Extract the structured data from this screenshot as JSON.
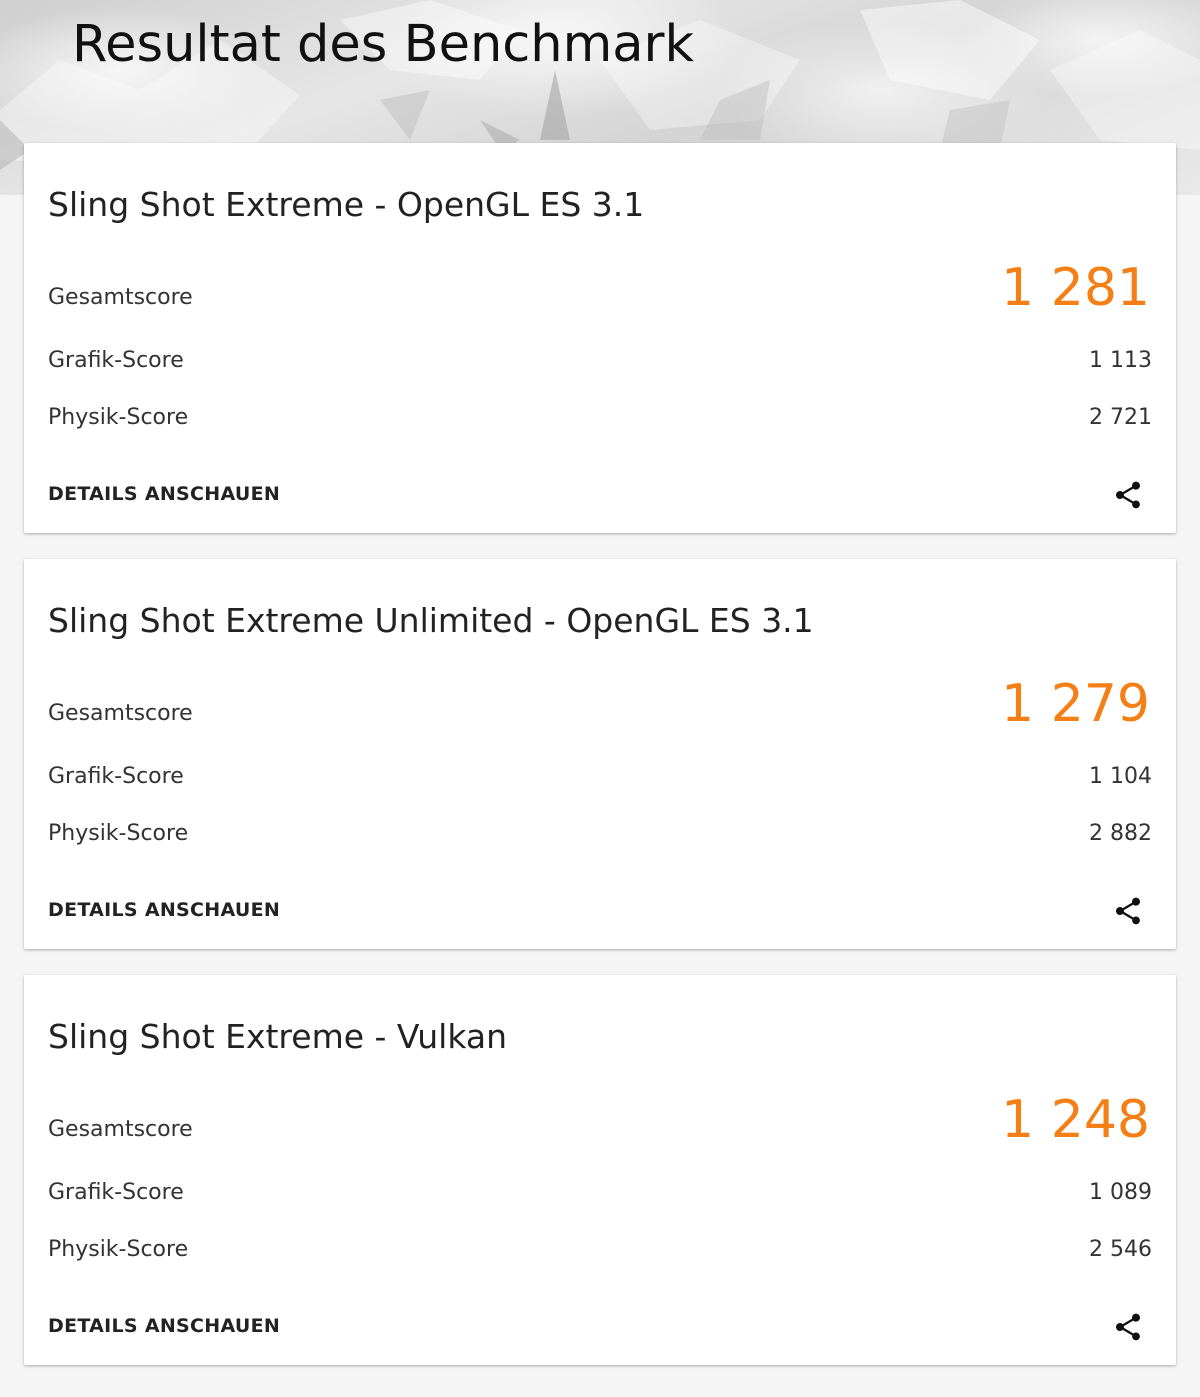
{
  "page": {
    "title": "Resultat des Benchmark"
  },
  "cards": [
    {
      "title": "Sling Shot Extreme - OpenGL ES 3.1",
      "total_label": "Gesamtscore",
      "total_value": "1 281",
      "graphics_label": "Grafik-Score",
      "graphics_value": "1 113",
      "physics_label": "Physik-Score",
      "physics_value": "2 721",
      "details_label": "DETAILS ANSCHAUEN",
      "share_icon": "share-icon"
    },
    {
      "title": "Sling Shot Extreme Unlimited - OpenGL ES 3.1",
      "total_label": "Gesamtscore",
      "total_value": "1 279",
      "graphics_label": "Grafik-Score",
      "graphics_value": "1 104",
      "physics_label": "Physik-Score",
      "physics_value": "2 882",
      "details_label": "DETAILS ANSCHAUEN",
      "share_icon": "share-icon"
    },
    {
      "title": "Sling Shot Extreme - Vulkan",
      "total_label": "Gesamtscore",
      "total_value": "1 248",
      "graphics_label": "Grafik-Score",
      "graphics_value": "1 089",
      "physics_label": "Physik-Score",
      "physics_value": "2 546",
      "details_label": "DETAILS ANSCHAUEN",
      "share_icon": "share-icon"
    }
  ],
  "colors": {
    "accent": "#f57f17",
    "text": "#222222",
    "background": "#f5f5f5",
    "card": "#ffffff"
  }
}
